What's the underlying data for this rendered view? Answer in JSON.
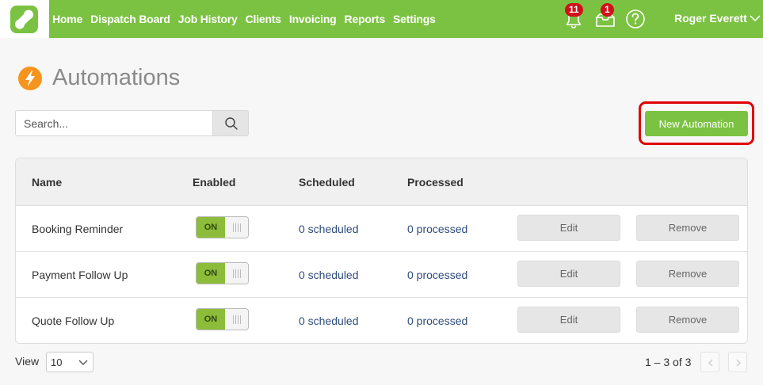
{
  "nav": {
    "items": [
      "Home",
      "Dispatch Board",
      "Job History",
      "Clients",
      "Invoicing",
      "Reports",
      "Settings"
    ],
    "notifications_count": "11",
    "messages_count": "1",
    "user_name": "Roger Everett"
  },
  "page": {
    "title": "Automations",
    "search_placeholder": "Search...",
    "new_button": "New Automation"
  },
  "table": {
    "headers": [
      "Name",
      "Enabled",
      "Scheduled",
      "Processed"
    ],
    "rows": [
      {
        "name": "Booking Reminder",
        "enabled": "ON",
        "scheduled": "0 scheduled",
        "processed": "0 processed",
        "edit": "Edit",
        "remove": "Remove"
      },
      {
        "name": "Payment Follow Up",
        "enabled": "ON",
        "scheduled": "0 scheduled",
        "processed": "0 processed",
        "edit": "Edit",
        "remove": "Remove"
      },
      {
        "name": "Quote Follow Up",
        "enabled": "ON",
        "scheduled": "0 scheduled",
        "processed": "0 processed",
        "edit": "Edit",
        "remove": "Remove"
      }
    ]
  },
  "footer": {
    "view_label": "View",
    "page_size": "10",
    "range": "1 – 3 of 3"
  },
  "colors": {
    "brand_green": "#7cc242",
    "highlight_red": "#e00000",
    "badge_red": "#d0101b",
    "accent_orange": "#f7941d",
    "link_blue": "#2f4c7d"
  },
  "icons": [
    "app-logo-icon",
    "bell-icon",
    "inbox-icon",
    "help-icon",
    "chevron-down-icon",
    "lightning-icon",
    "search-icon",
    "chevron-left-icon",
    "chevron-right-icon"
  ]
}
